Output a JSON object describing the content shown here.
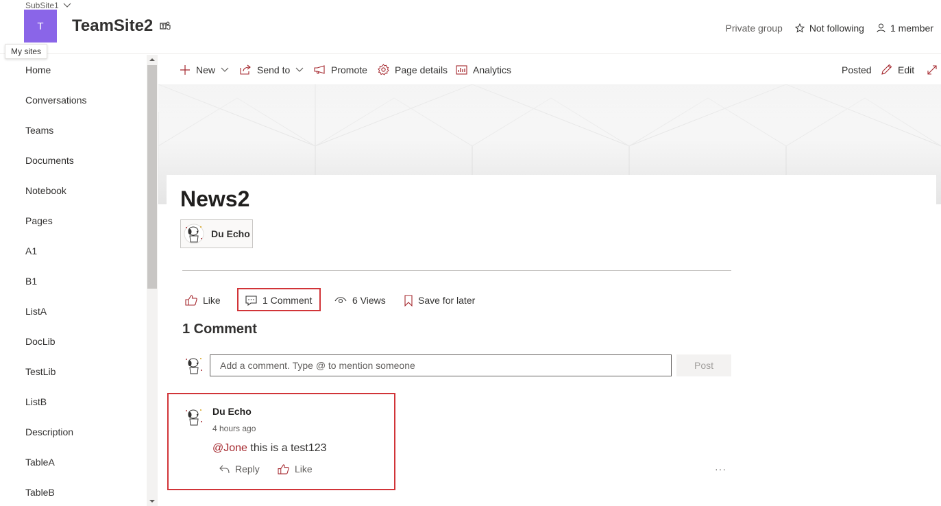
{
  "header": {
    "subsite_label": "SubSite1",
    "logo_letter": "T",
    "site_title": "TeamSite2",
    "privacy": "Private group",
    "follow": "Not following",
    "members": "1 member",
    "tooltip": "My sites"
  },
  "nav": {
    "items": [
      {
        "label": "Home"
      },
      {
        "label": "Conversations"
      },
      {
        "label": "Teams"
      },
      {
        "label": "Documents"
      },
      {
        "label": "Notebook"
      },
      {
        "label": "Pages"
      },
      {
        "label": "A1"
      },
      {
        "label": "B1"
      },
      {
        "label": "ListA"
      },
      {
        "label": "DocLib"
      },
      {
        "label": "TestLib"
      },
      {
        "label": "ListB"
      },
      {
        "label": "Description"
      },
      {
        "label": "TableA"
      },
      {
        "label": "TableB"
      }
    ]
  },
  "commandbar": {
    "new": "New",
    "send_to": "Send to",
    "promote": "Promote",
    "page_details": "Page details",
    "analytics": "Analytics",
    "status": "Posted",
    "edit": "Edit"
  },
  "page": {
    "title": "News2",
    "author": "Du Echo"
  },
  "social": {
    "like": "Like",
    "comments": "1 Comment",
    "views": "6 Views",
    "save": "Save for later"
  },
  "comments": {
    "heading": "1 Comment",
    "placeholder": "Add a comment. Type @ to mention someone",
    "post": "Post",
    "items": [
      {
        "author": "Du Echo",
        "time": "4 hours ago",
        "mention": "@Jone",
        "text": " this is a test123",
        "reply": "Reply",
        "like": "Like",
        "more": "···"
      }
    ]
  },
  "colors": {
    "logo": "#8a65e8",
    "accent": "#a4262c",
    "highlight": "#d13438"
  }
}
